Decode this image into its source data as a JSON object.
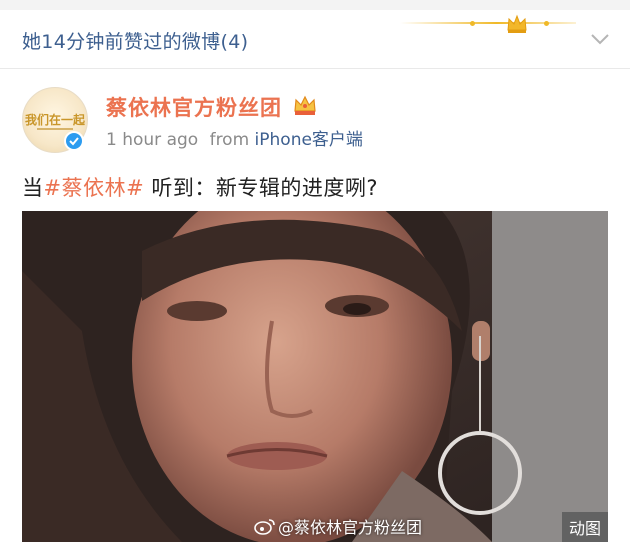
{
  "liked_header": {
    "title": "她14分钟前赞过的微博(4)"
  },
  "post": {
    "author": "蔡依林官方粉丝团",
    "avatar_text": "我们在一起",
    "time": "1 hour ago",
    "from_label": "from",
    "source": "iPhone客户端",
    "text_prefix": "当",
    "hashtag": "#蔡依林#",
    "text_suffix": " 听到：新专辑的进度咧?"
  },
  "media": {
    "watermark": "@蔡依林官方粉丝团",
    "type_badge": "动图"
  },
  "colors": {
    "link_blue": "#3d5f8f",
    "orange": "#eb7350",
    "gold": "#f0b928"
  },
  "icons": [
    "crown-icon",
    "chevron-down-icon",
    "verified-icon",
    "member-crown-icon",
    "weibo-logo-icon"
  ]
}
